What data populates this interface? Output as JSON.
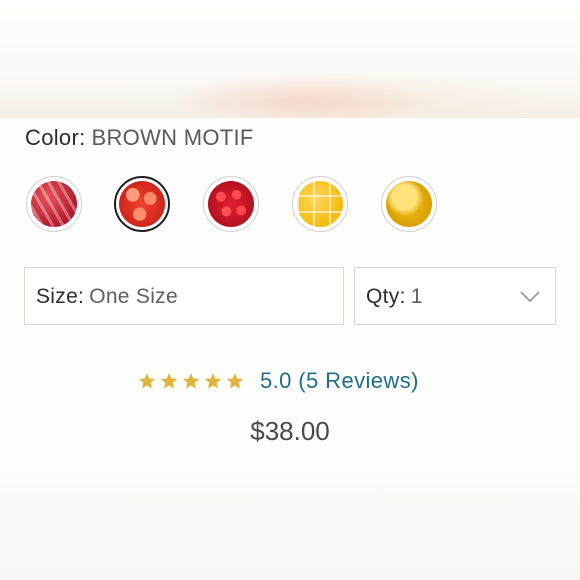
{
  "colors": {
    "accent_link": "#1f6f8b",
    "star": "#e0b43c",
    "border": "#d6d6d6"
  },
  "color_selector": {
    "label": "Color:",
    "value": "BROWN MOTIF",
    "swatches": [
      {
        "name": "red-crystal-swatch",
        "icon": "red-crystal-beads",
        "selected": false
      },
      {
        "name": "coral-bead-swatch",
        "icon": "coral-red-beads",
        "selected": true
      },
      {
        "name": "red-sequin-swatch",
        "icon": "red-sequins",
        "selected": false
      },
      {
        "name": "yellow-cube-swatch",
        "icon": "yellow-cubes",
        "selected": false
      },
      {
        "name": "gold-square-swatch",
        "icon": "gold-square",
        "selected": false
      }
    ]
  },
  "size_select": {
    "label": "Size:",
    "value": "One Size"
  },
  "qty_select": {
    "label": "Qty:",
    "value": "1",
    "icon": "chevron-down-icon"
  },
  "rating": {
    "stars": 5,
    "max_stars": 5,
    "text": "5.0 (5 Reviews)"
  },
  "price": "$38.00"
}
